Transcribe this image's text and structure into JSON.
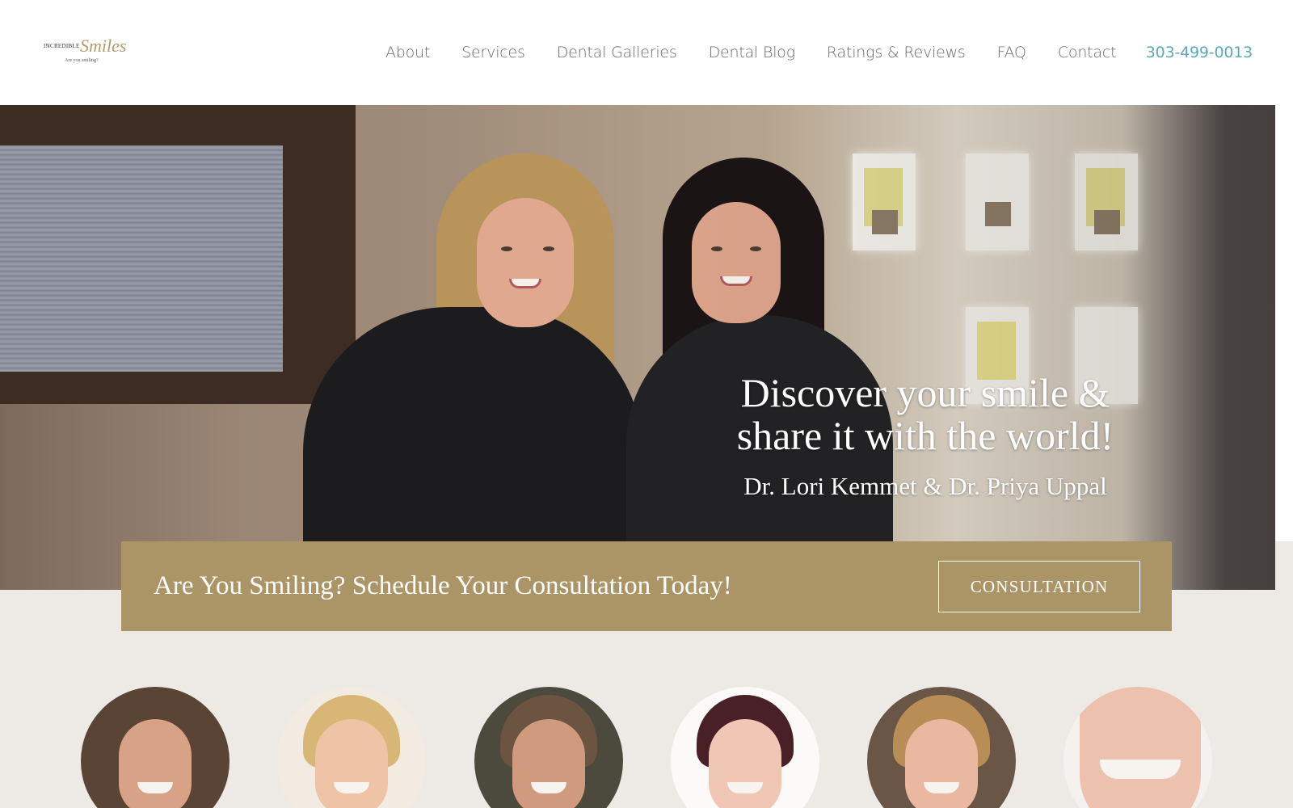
{
  "logo": {
    "word_a": "INCREDIBLE",
    "word_b": "Smiles",
    "tagline": "Are you smiling?"
  },
  "nav": {
    "items": [
      {
        "label": "About"
      },
      {
        "label": "Services"
      },
      {
        "label": "Dental Galleries"
      },
      {
        "label": "Dental Blog"
      },
      {
        "label": "Ratings & Reviews"
      },
      {
        "label": "FAQ"
      },
      {
        "label": "Contact"
      }
    ],
    "phone": "303-499-0013"
  },
  "hero": {
    "title_line1": "Discover your smile &",
    "title_line2": "share it with the world!",
    "subtitle": "Dr. Lori Kemmet & Dr. Priya Uppal"
  },
  "cta": {
    "text": "Are You Smiling? Schedule Your Consultation Today!",
    "button_label": "CONSULTATION"
  },
  "colors": {
    "accent_gold": "#ab9566",
    "phone_blue": "#5ea9b8",
    "page_bg": "#edeae5"
  }
}
